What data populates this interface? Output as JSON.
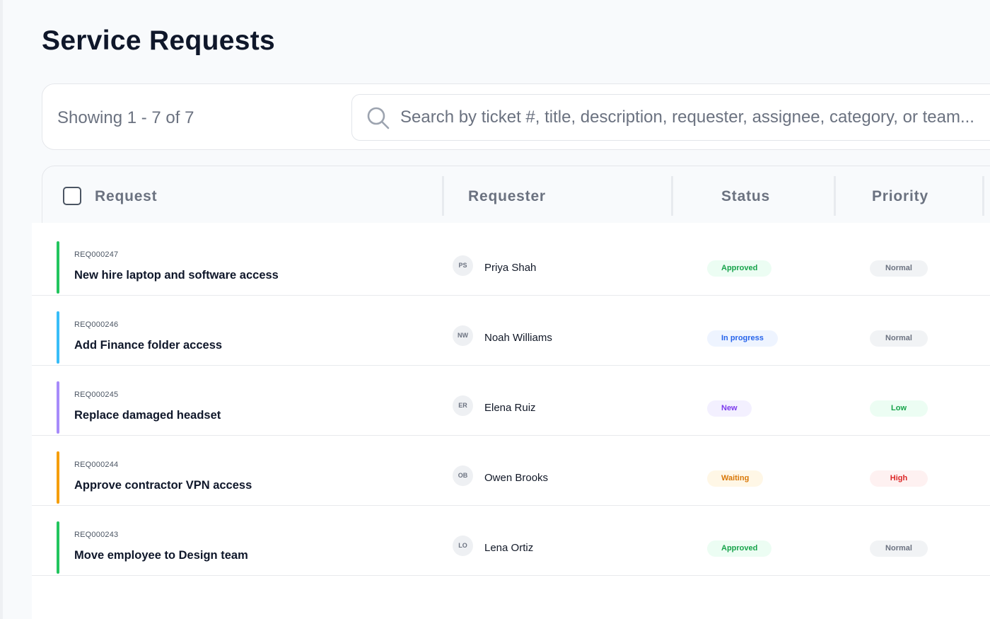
{
  "page": {
    "title": "Service Requests"
  },
  "toolbar": {
    "showing": "Showing 1 - 7 of 7",
    "search_placeholder": "Search by ticket #, title, description, requester, assignee, category, or team..."
  },
  "table": {
    "columns": [
      "Request",
      "Requester",
      "Status",
      "Priority"
    ],
    "rows": [
      {
        "ticket": "REQ000247",
        "title": "New hire laptop and software access",
        "initials": "PS",
        "requester": "Priya Shah",
        "status": "Approved",
        "priority": "Normal",
        "accent": "#22c55e",
        "status_bg": "#ecfdf3",
        "status_fg": "#16a34a",
        "priority_bg": "#f1f3f5",
        "priority_fg": "#6b7280"
      },
      {
        "ticket": "REQ000246",
        "title": "Add Finance folder access",
        "initials": "NW",
        "requester": "Noah Williams",
        "status": "In progress",
        "priority": "Normal",
        "accent": "#38bdf8",
        "status_bg": "#eef4ff",
        "status_fg": "#2563eb",
        "priority_bg": "#f1f3f5",
        "priority_fg": "#6b7280"
      },
      {
        "ticket": "REQ000245",
        "title": "Replace damaged headset",
        "initials": "ER",
        "requester": "Elena Ruiz",
        "status": "New",
        "priority": "Low",
        "accent": "#a78bfa",
        "status_bg": "#f3f0ff",
        "status_fg": "#7c3aed",
        "priority_bg": "#ecfdf3",
        "priority_fg": "#16a34a"
      },
      {
        "ticket": "REQ000244",
        "title": "Approve contractor VPN access",
        "initials": "OB",
        "requester": "Owen Brooks",
        "status": "Waiting",
        "priority": "High",
        "accent": "#f59e0b",
        "status_bg": "#fff7e6",
        "status_fg": "#d97706",
        "priority_bg": "#fef1f1",
        "priority_fg": "#dc2626"
      },
      {
        "ticket": "REQ000243",
        "title": "Move employee to Design team",
        "initials": "LO",
        "requester": "Lena Ortiz",
        "status": "Approved",
        "priority": "Normal",
        "accent": "#22c55e",
        "status_bg": "#ecfdf3",
        "status_fg": "#16a34a",
        "priority_bg": "#f1f3f5",
        "priority_fg": "#6b7280"
      }
    ]
  },
  "icons": {
    "search": "search-icon"
  }
}
